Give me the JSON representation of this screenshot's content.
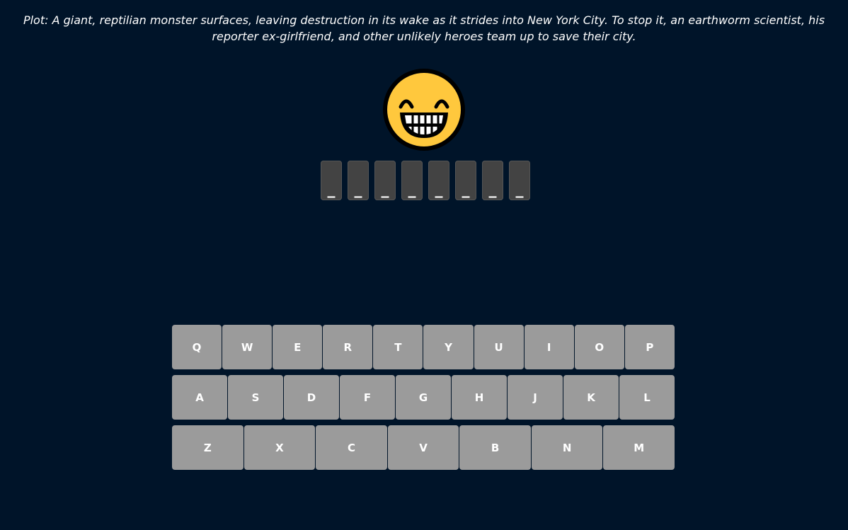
{
  "plot": {
    "text": "Plot: A giant, reptilian monster surfaces, leaving destruction in its wake as it strides into New York City. To stop it, an earthworm scientist, his reporter ex-girlfriend, and other unlikely heroes team up to save their city."
  },
  "status_face": {
    "icon": "grinning-face-icon",
    "color": "#FFC83D"
  },
  "word_slots": [
    "_",
    "_",
    "_",
    "_",
    "_",
    "_",
    "_",
    "_"
  ],
  "keyboard": {
    "rows": [
      [
        "Q",
        "W",
        "E",
        "R",
        "T",
        "Y",
        "U",
        "I",
        "O",
        "P"
      ],
      [
        "A",
        "S",
        "D",
        "F",
        "G",
        "H",
        "J",
        "K",
        "L"
      ],
      [
        "Z",
        "X",
        "C",
        "V",
        "B",
        "N",
        "M"
      ]
    ],
    "key_color": "#9B9B9B",
    "background_color": "#001429"
  }
}
